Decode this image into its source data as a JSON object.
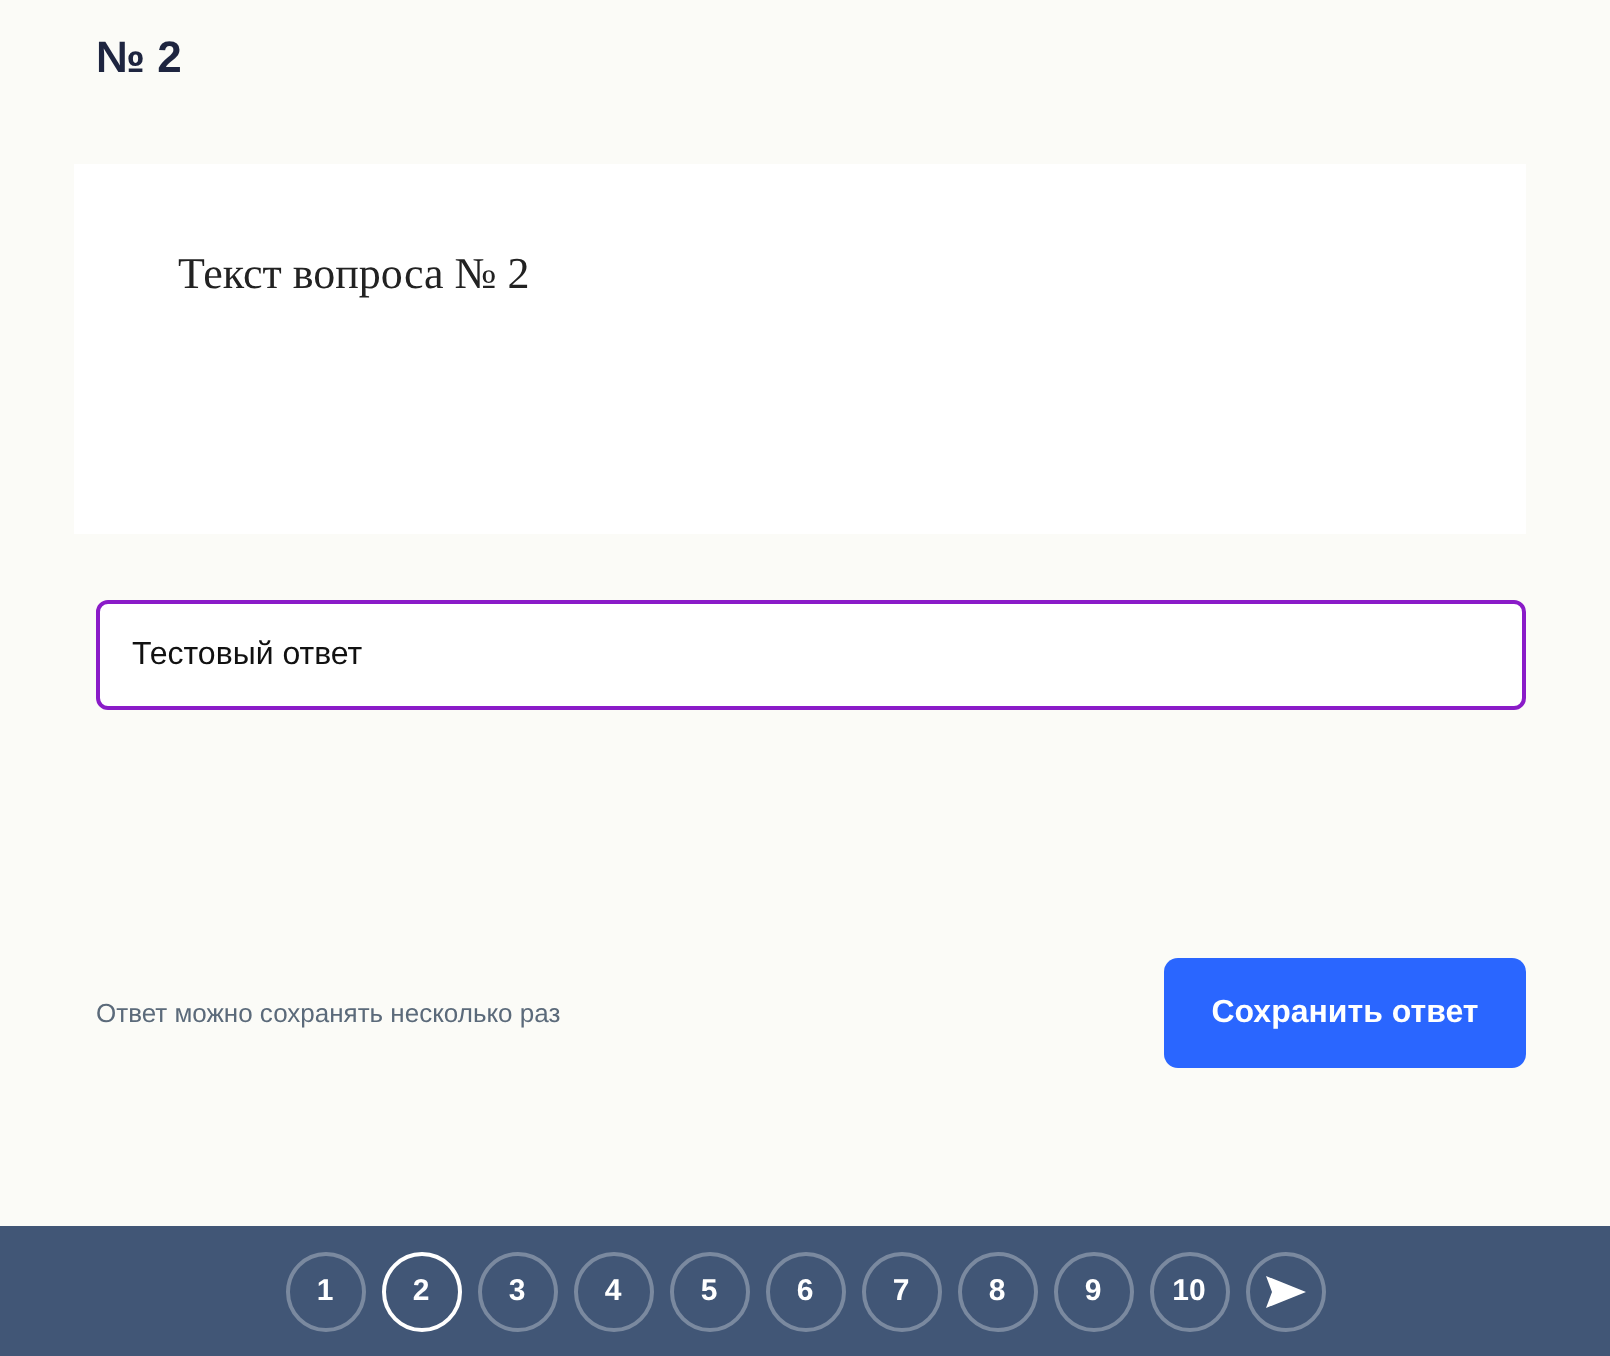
{
  "heading": "№ 2",
  "question": {
    "text": "Текст вопроса № 2"
  },
  "answer": {
    "value": "Тестовый ответ"
  },
  "hint": "Ответ можно сохранять несколько раз",
  "save_button": "Сохранить ответ",
  "pages": [
    {
      "label": "1",
      "selected": false
    },
    {
      "label": "2",
      "selected": true
    },
    {
      "label": "3",
      "selected": false
    },
    {
      "label": "4",
      "selected": false
    },
    {
      "label": "5",
      "selected": false
    },
    {
      "label": "6",
      "selected": false
    },
    {
      "label": "7",
      "selected": false
    },
    {
      "label": "8",
      "selected": false
    },
    {
      "label": "9",
      "selected": false
    },
    {
      "label": "10",
      "selected": false
    }
  ]
}
